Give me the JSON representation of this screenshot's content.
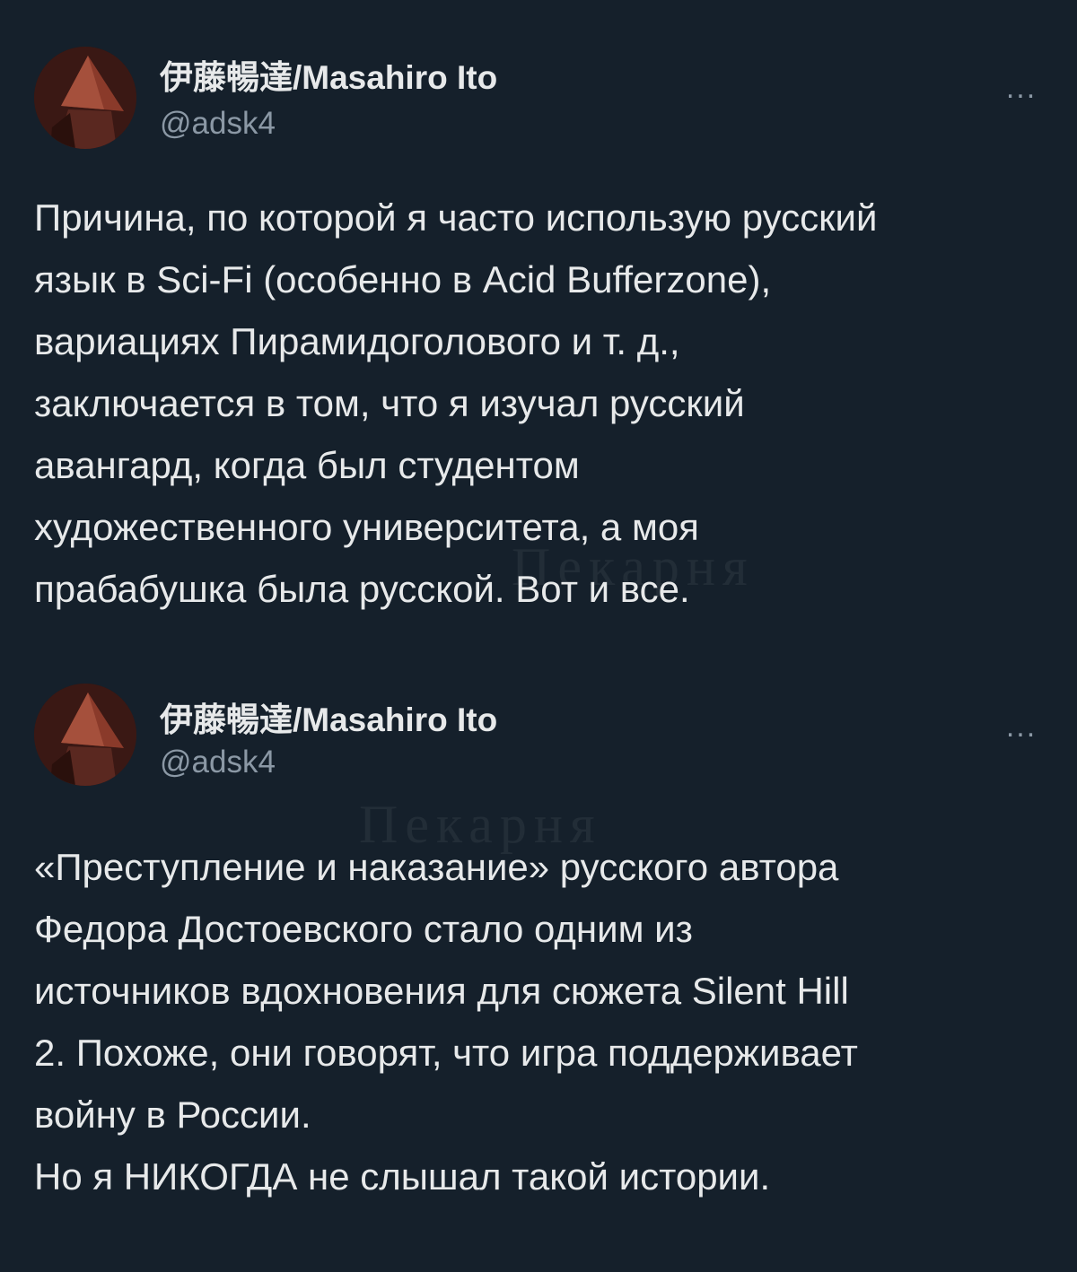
{
  "tweets": [
    {
      "display_name": "伊藤暢達/Masahiro Ito",
      "handle": "@adsk4",
      "more_label": "...",
      "text": "Причина, по которой я часто использую русский\nязык в Sci-Fi (особенно в Acid Bufferzone),\nвариациях Пирамидоголового и т. д.,\nзаключается в том, что я изучал русский\nавангард, когда был студентом\nхудожественного университета, а моя\nпрабабушка была русской. Вот и все."
    },
    {
      "display_name": "伊藤暢達/Masahiro Ito",
      "handle": "@adsk4",
      "more_label": "...",
      "text": "«Преступление и наказание» русского автора\nФедора Достоевского стало одним из\nисточников вдохновения для сюжета Silent Hill\n2. Похоже, они говорят, что игра поддерживает\nвойну в России.\nНо я НИКОГДА не слышал такой истории."
    }
  ],
  "watermark": "Пекарня",
  "colors": {
    "background": "#15202b",
    "text": "#e7e9ea",
    "secondary": "#8b98a5"
  }
}
